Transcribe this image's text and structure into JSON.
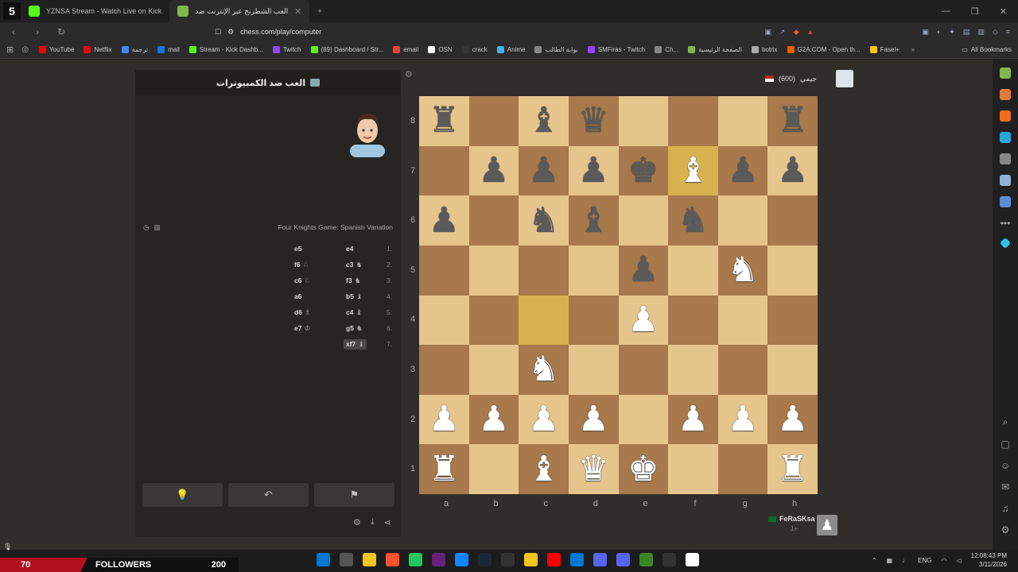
{
  "browser": {
    "tabs": [
      {
        "title": "YZNSA Stream - Watch Live on Kick",
        "active": false,
        "color": "#53fc18"
      },
      {
        "title": "العب الشطرنج عبر الإنترنت ضد",
        "active": true,
        "color": "#81b64c"
      }
    ],
    "new_tab_label": "+",
    "url": "chess.com/play/computer",
    "bookmarks": [
      {
        "label": "YouTube",
        "color": "#ff0000"
      },
      {
        "label": "Netflix",
        "color": "#e50914"
      },
      {
        "label": "ترجمة",
        "color": "#4285f4"
      },
      {
        "label": "mail",
        "color": "#1a73e8"
      },
      {
        "label": "Stream - Kick Dashb...",
        "color": "#53fc18"
      },
      {
        "label": "Twitch",
        "color": "#9146ff"
      },
      {
        "label": "(89) Dashboard / Str...",
        "color": "#53fc18"
      },
      {
        "label": "email",
        "color": "#ea4335"
      },
      {
        "label": "OSN",
        "color": "#ffffff"
      },
      {
        "label": "crack",
        "color": "#333333"
      },
      {
        "label": "Anime",
        "color": "#3db4f2"
      },
      {
        "label": "بوابة الطالب",
        "color": "#888888"
      },
      {
        "label": "SMFiras - Twitch",
        "color": "#9146ff"
      },
      {
        "label": "Ch...",
        "color": "#888888"
      },
      {
        "label": "الصفحة الرئيسية",
        "color": "#81b64c"
      },
      {
        "label": "botrix",
        "color": "#aaaaaa"
      },
      {
        "label": "G2A.COM - Open th...",
        "color": "#f05f00"
      },
      {
        "label": "Fasel+",
        "color": "#f5c518"
      }
    ],
    "all_bookmarks": "All Bookmarks"
  },
  "panel": {
    "title": "العب ضد الكمبيوترات",
    "opening": "Four Knights Game: Spanish Variation",
    "moves": [
      {
        "num": "1.",
        "white": "e4",
        "wp": "",
        "black": "e5",
        "bp": ""
      },
      {
        "num": "2.",
        "white": "c3",
        "wp": "♞",
        "black": "f6",
        "bp": "♘"
      },
      {
        "num": "3.",
        "white": "f3",
        "wp": "♞",
        "black": "c6",
        "bp": "♘"
      },
      {
        "num": "4.",
        "white": "b5",
        "wp": "♝",
        "black": "a6",
        "bp": ""
      },
      {
        "num": "5.",
        "white": "c4",
        "wp": "♝",
        "black": "d6",
        "bp": "♗"
      },
      {
        "num": "6.",
        "white": "g5",
        "wp": "♞",
        "black": "e7",
        "bp": "♔"
      },
      {
        "num": "7.",
        "white": "xf7",
        "wp": "♝",
        "black": "",
        "bp": ""
      }
    ]
  },
  "board": {
    "ranks": [
      "8",
      "7",
      "6",
      "5",
      "4",
      "3",
      "2",
      "1"
    ],
    "files": [
      "a",
      "b",
      "c",
      "d",
      "e",
      "f",
      "g",
      "h"
    ],
    "position": [
      [
        "br",
        "",
        "bb",
        "bq",
        "",
        "",
        "",
        "br"
      ],
      [
        "",
        "bp",
        "bp",
        "bp",
        "bk",
        "wb",
        "bp",
        "bp"
      ],
      [
        "bp",
        "",
        "bn",
        "bb",
        "",
        "bn",
        "",
        ""
      ],
      [
        "",
        "",
        "",
        "",
        "bp",
        "",
        "wn",
        ""
      ],
      [
        "",
        "",
        "",
        "",
        "wp",
        "",
        "",
        ""
      ],
      [
        "",
        "",
        "wn",
        "",
        "",
        "",
        "",
        ""
      ],
      [
        "wp",
        "wp",
        "wp",
        "wp",
        "",
        "wp",
        "wp",
        "wp"
      ],
      [
        "wr",
        "",
        "wb",
        "wq",
        "wk",
        "",
        "",
        "wr"
      ]
    ],
    "highlights": [
      "c4",
      "f7"
    ]
  },
  "players": {
    "top": {
      "name": "جيمي",
      "rating": "(600)"
    },
    "bottom": {
      "name": "FeRaSKsa",
      "rating": "1+"
    }
  },
  "stream": {
    "count": "70",
    "label": "FOLLOWERS",
    "goal": "200"
  },
  "taskbar": {
    "lang": "ENG",
    "time": "12:08:43 PM",
    "date": "3/11/2026",
    "icons": [
      "#0078d4",
      "#555555",
      "#f5c518",
      "#fb542b",
      "#22c55e",
      "#68217a",
      "#0a84ff",
      "#1b2838",
      "#333333",
      "#f5c518",
      "#ff0000",
      "#0078d4",
      "#5865f2",
      "#5865f2",
      "#3c8527",
      "#333333",
      "#ffffff"
    ]
  }
}
